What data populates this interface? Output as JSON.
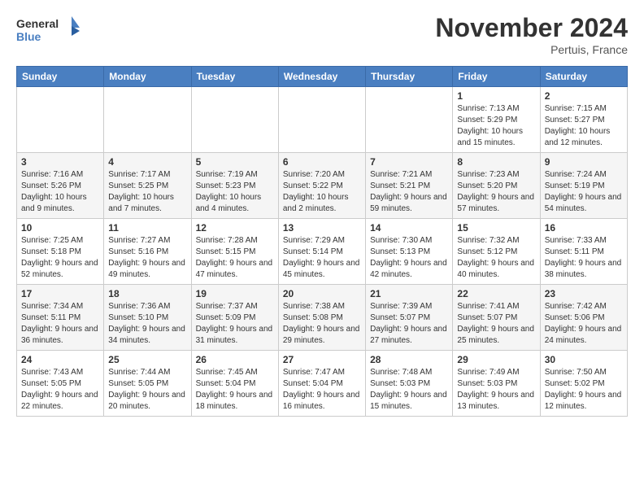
{
  "header": {
    "logo_line1": "General",
    "logo_line2": "Blue",
    "month": "November 2024",
    "location": "Pertuis, France"
  },
  "weekdays": [
    "Sunday",
    "Monday",
    "Tuesday",
    "Wednesday",
    "Thursday",
    "Friday",
    "Saturday"
  ],
  "weeks": [
    [
      {
        "day": "",
        "info": ""
      },
      {
        "day": "",
        "info": ""
      },
      {
        "day": "",
        "info": ""
      },
      {
        "day": "",
        "info": ""
      },
      {
        "day": "",
        "info": ""
      },
      {
        "day": "1",
        "info": "Sunrise: 7:13 AM\nSunset: 5:29 PM\nDaylight: 10 hours and 15 minutes."
      },
      {
        "day": "2",
        "info": "Sunrise: 7:15 AM\nSunset: 5:27 PM\nDaylight: 10 hours and 12 minutes."
      }
    ],
    [
      {
        "day": "3",
        "info": "Sunrise: 7:16 AM\nSunset: 5:26 PM\nDaylight: 10 hours and 9 minutes."
      },
      {
        "day": "4",
        "info": "Sunrise: 7:17 AM\nSunset: 5:25 PM\nDaylight: 10 hours and 7 minutes."
      },
      {
        "day": "5",
        "info": "Sunrise: 7:19 AM\nSunset: 5:23 PM\nDaylight: 10 hours and 4 minutes."
      },
      {
        "day": "6",
        "info": "Sunrise: 7:20 AM\nSunset: 5:22 PM\nDaylight: 10 hours and 2 minutes."
      },
      {
        "day": "7",
        "info": "Sunrise: 7:21 AM\nSunset: 5:21 PM\nDaylight: 9 hours and 59 minutes."
      },
      {
        "day": "8",
        "info": "Sunrise: 7:23 AM\nSunset: 5:20 PM\nDaylight: 9 hours and 57 minutes."
      },
      {
        "day": "9",
        "info": "Sunrise: 7:24 AM\nSunset: 5:19 PM\nDaylight: 9 hours and 54 minutes."
      }
    ],
    [
      {
        "day": "10",
        "info": "Sunrise: 7:25 AM\nSunset: 5:18 PM\nDaylight: 9 hours and 52 minutes."
      },
      {
        "day": "11",
        "info": "Sunrise: 7:27 AM\nSunset: 5:16 PM\nDaylight: 9 hours and 49 minutes."
      },
      {
        "day": "12",
        "info": "Sunrise: 7:28 AM\nSunset: 5:15 PM\nDaylight: 9 hours and 47 minutes."
      },
      {
        "day": "13",
        "info": "Sunrise: 7:29 AM\nSunset: 5:14 PM\nDaylight: 9 hours and 45 minutes."
      },
      {
        "day": "14",
        "info": "Sunrise: 7:30 AM\nSunset: 5:13 PM\nDaylight: 9 hours and 42 minutes."
      },
      {
        "day": "15",
        "info": "Sunrise: 7:32 AM\nSunset: 5:12 PM\nDaylight: 9 hours and 40 minutes."
      },
      {
        "day": "16",
        "info": "Sunrise: 7:33 AM\nSunset: 5:11 PM\nDaylight: 9 hours and 38 minutes."
      }
    ],
    [
      {
        "day": "17",
        "info": "Sunrise: 7:34 AM\nSunset: 5:11 PM\nDaylight: 9 hours and 36 minutes."
      },
      {
        "day": "18",
        "info": "Sunrise: 7:36 AM\nSunset: 5:10 PM\nDaylight: 9 hours and 34 minutes."
      },
      {
        "day": "19",
        "info": "Sunrise: 7:37 AM\nSunset: 5:09 PM\nDaylight: 9 hours and 31 minutes."
      },
      {
        "day": "20",
        "info": "Sunrise: 7:38 AM\nSunset: 5:08 PM\nDaylight: 9 hours and 29 minutes."
      },
      {
        "day": "21",
        "info": "Sunrise: 7:39 AM\nSunset: 5:07 PM\nDaylight: 9 hours and 27 minutes."
      },
      {
        "day": "22",
        "info": "Sunrise: 7:41 AM\nSunset: 5:07 PM\nDaylight: 9 hours and 25 minutes."
      },
      {
        "day": "23",
        "info": "Sunrise: 7:42 AM\nSunset: 5:06 PM\nDaylight: 9 hours and 24 minutes."
      }
    ],
    [
      {
        "day": "24",
        "info": "Sunrise: 7:43 AM\nSunset: 5:05 PM\nDaylight: 9 hours and 22 minutes."
      },
      {
        "day": "25",
        "info": "Sunrise: 7:44 AM\nSunset: 5:05 PM\nDaylight: 9 hours and 20 minutes."
      },
      {
        "day": "26",
        "info": "Sunrise: 7:45 AM\nSunset: 5:04 PM\nDaylight: 9 hours and 18 minutes."
      },
      {
        "day": "27",
        "info": "Sunrise: 7:47 AM\nSunset: 5:04 PM\nDaylight: 9 hours and 16 minutes."
      },
      {
        "day": "28",
        "info": "Sunrise: 7:48 AM\nSunset: 5:03 PM\nDaylight: 9 hours and 15 minutes."
      },
      {
        "day": "29",
        "info": "Sunrise: 7:49 AM\nSunset: 5:03 PM\nDaylight: 9 hours and 13 minutes."
      },
      {
        "day": "30",
        "info": "Sunrise: 7:50 AM\nSunset: 5:02 PM\nDaylight: 9 hours and 12 minutes."
      }
    ]
  ]
}
